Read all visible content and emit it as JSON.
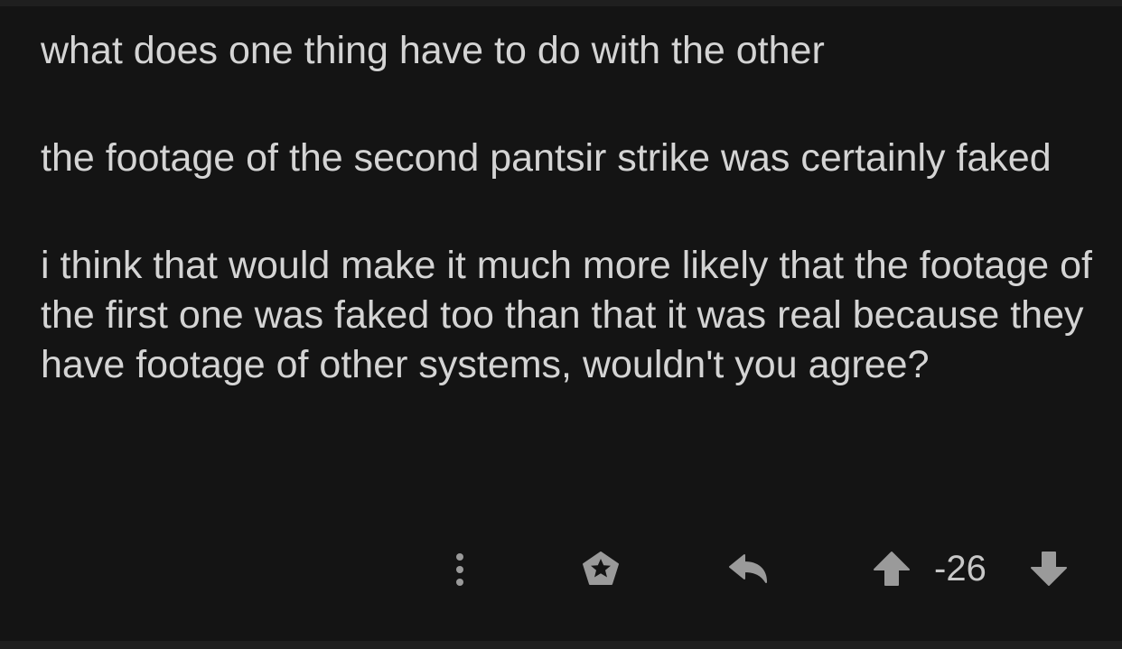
{
  "comment": {
    "paragraphs": [
      "what does one thing have to do with the other",
      "the footage of the second pantsir strike was certainly faked",
      "i think that would make it much more likely that the footage of the first one was faked too than that it was real because they have footage of other systems, wouldn't you agree?"
    ]
  },
  "actions": {
    "icons": {
      "more": "more-vertical-icon",
      "award": "award-icon",
      "reply": "reply-icon",
      "upvote": "upvote-arrow-icon",
      "downvote": "downvote-arrow-icon"
    },
    "score": "-26"
  },
  "colors": {
    "background": "#141414",
    "text": "#d4d4d4",
    "icon": "#9a9a9a"
  }
}
